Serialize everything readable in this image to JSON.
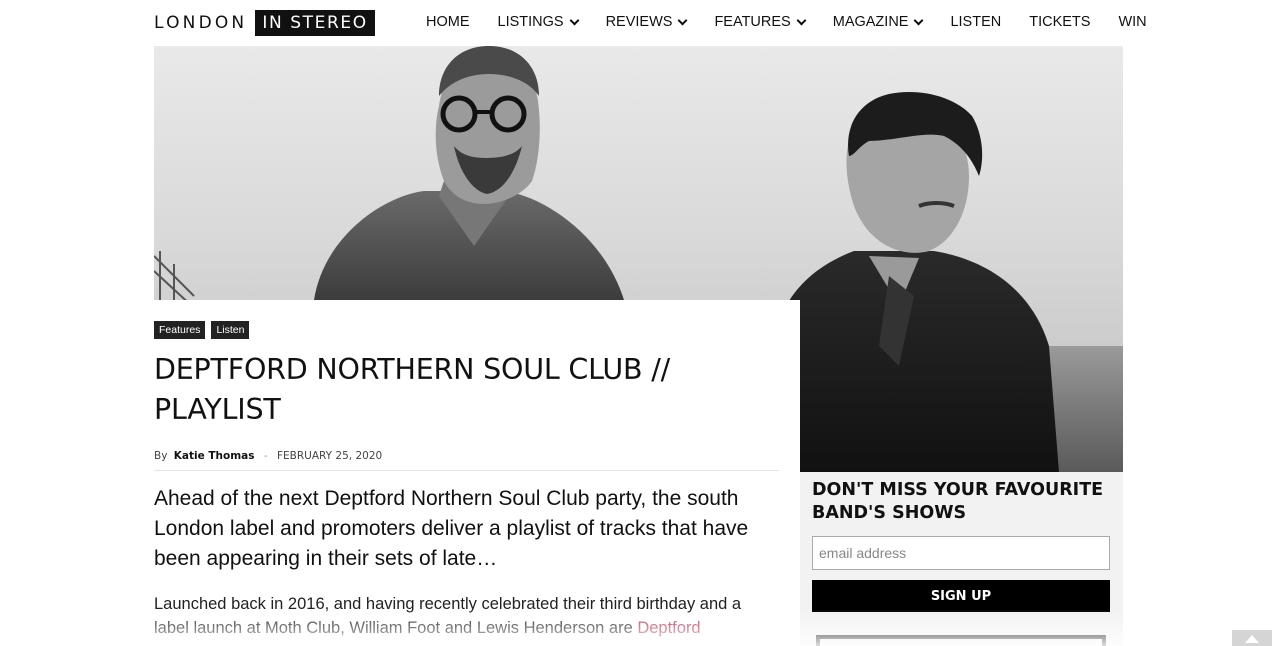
{
  "header": {
    "logo_london": "LONDON",
    "logo_stereo": "IN STEREO",
    "nav": [
      {
        "label": "HOME",
        "dropdown": false
      },
      {
        "label": "LISTINGS",
        "dropdown": true
      },
      {
        "label": "REVIEWS",
        "dropdown": true
      },
      {
        "label": "FEATURES",
        "dropdown": true
      },
      {
        "label": "MAGAZINE",
        "dropdown": true
      },
      {
        "label": "LISTEN",
        "dropdown": false
      },
      {
        "label": "TICKETS",
        "dropdown": false
      },
      {
        "label": "WIN",
        "dropdown": false
      }
    ]
  },
  "article": {
    "tags": [
      "Features",
      "Listen"
    ],
    "title": "DEPTFORD NORTHERN SOUL CLUB // PLAYLIST",
    "by": "By",
    "author": "Katie Thomas",
    "separator": "-",
    "date": "FEBRUARY 25, 2020",
    "lead": "Ahead of the next Deptford Northern Soul Club party, the south London label and promoters deliver a playlist of tracks that have been appearing in their sets of late…",
    "body_start": "Launched back in 2016, and having recently celebrated their third birthday and a label launch at Moth Club, William Foot and Lewis Henderson are ",
    "body_link": "Deptford",
    "link_color": "#c0314e"
  },
  "signup": {
    "title": "DON'T MISS YOUR FAVOURITE BAND'S SHOWS",
    "input_placeholder": "email address",
    "button_label": "SIGN UP"
  },
  "icons": {
    "nav_dropdown": "chevron-down-icon",
    "back_to_top": "arrow-up-icon"
  }
}
